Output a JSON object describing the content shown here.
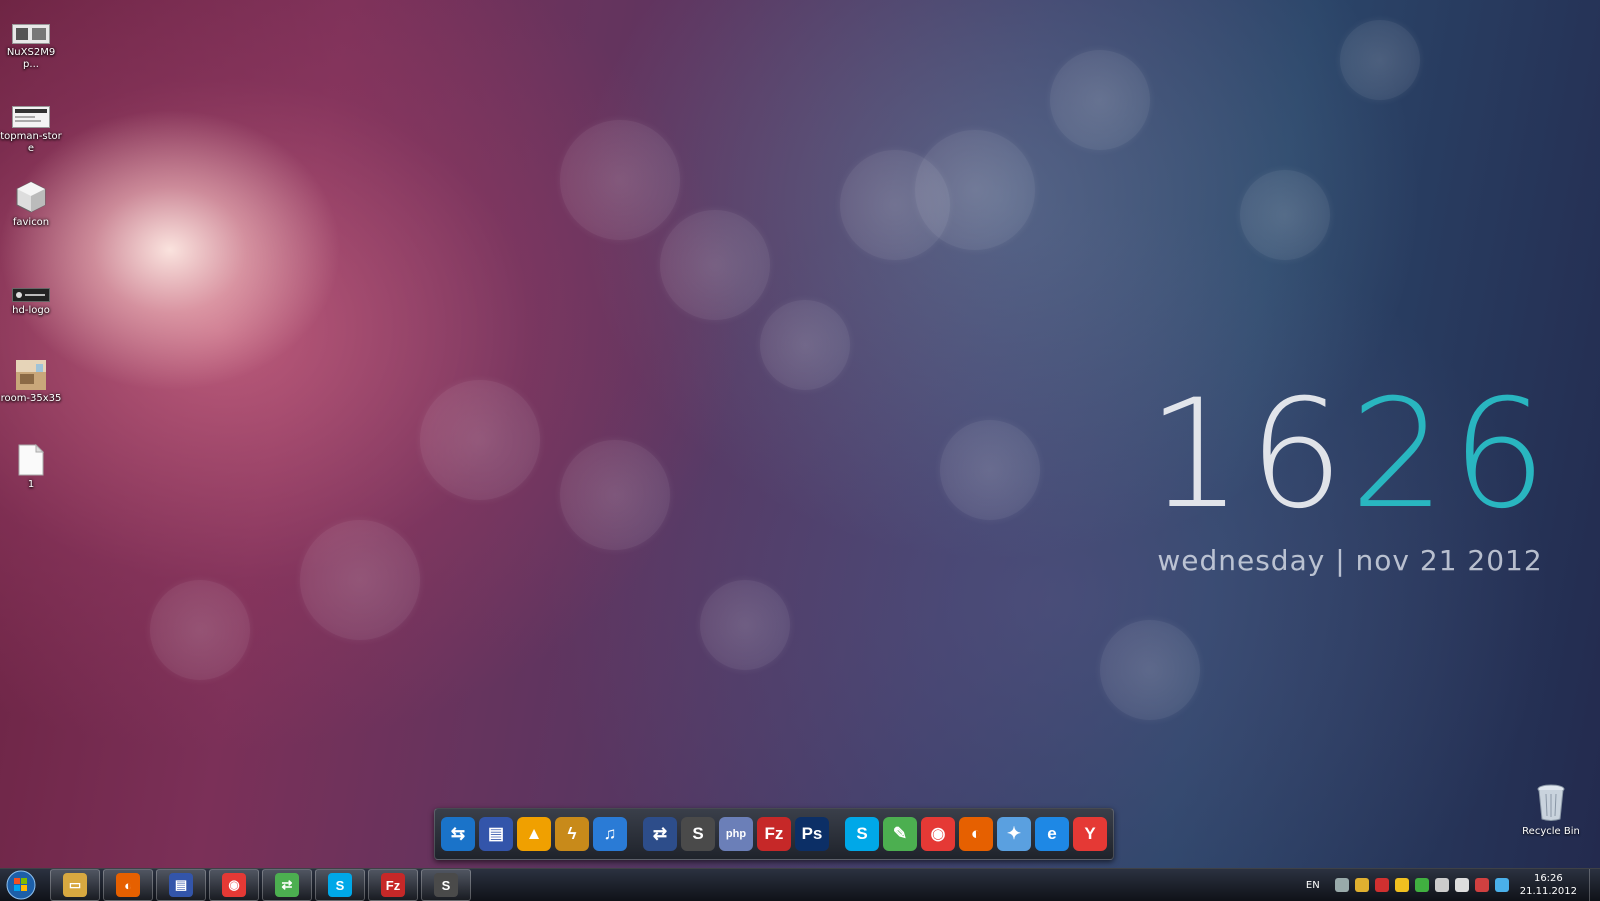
{
  "desktop_icons": [
    {
      "label": "NuXS2M9p...",
      "icon": "image-thumbnail-icon"
    },
    {
      "label": "topman-store",
      "icon": "image-thumbnail-icon"
    },
    {
      "label": "favicon",
      "icon": "favicon-cube-icon"
    },
    {
      "label": "hd-logo",
      "icon": "logo-thumbnail-icon"
    },
    {
      "label": "room-35x35",
      "icon": "room-photo-icon"
    },
    {
      "label": "1",
      "icon": "text-document-icon"
    }
  ],
  "clock_widget": {
    "hours": "16",
    "minutes": "26",
    "date_line": "wednesday | nov 21 2012",
    "accent_color": "#29b6c0"
  },
  "dock": {
    "groups": [
      [
        {
          "name": "teamviewer",
          "glyph": "⇆",
          "color": "#1a73c9"
        },
        {
          "name": "floppy-save",
          "glyph": "▤",
          "color": "#3355aa"
        },
        {
          "name": "aimp",
          "glyph": "▲",
          "color": "#f0a000"
        },
        {
          "name": "winamp",
          "glyph": "ϟ",
          "color": "#c88a1a"
        },
        {
          "name": "itunes",
          "glyph": "♫",
          "color": "#2a7bd6"
        }
      ],
      [
        {
          "name": "network-tool",
          "glyph": "⇄",
          "color": "#2d4d8a"
        },
        {
          "name": "sublime-text",
          "glyph": "S",
          "color": "#4a4a4a"
        },
        {
          "name": "php",
          "glyph": "php",
          "color": "#6b7fb8"
        },
        {
          "name": "filezilla",
          "glyph": "Fz",
          "color": "#c62828"
        },
        {
          "name": "photoshop",
          "glyph": "Ps",
          "color": "#0c2f66"
        }
      ],
      [
        {
          "name": "skype",
          "glyph": "S",
          "color": "#00a8e8"
        },
        {
          "name": "evernote-like",
          "glyph": "✎",
          "color": "#4caf50"
        },
        {
          "name": "chrome",
          "glyph": "◉",
          "color": "#e53935"
        },
        {
          "name": "firefox",
          "glyph": "◐",
          "color": "#e66000"
        },
        {
          "name": "safari",
          "glyph": "✦",
          "color": "#5aa0e0"
        },
        {
          "name": "internet-explorer",
          "glyph": "e",
          "color": "#1e88e5"
        },
        {
          "name": "yandex-browser",
          "glyph": "Y",
          "color": "#e53935"
        }
      ]
    ]
  },
  "recycle_bin": {
    "label": "Recycle Bin"
  },
  "taskbar": {
    "pinned": [
      {
        "name": "explorer",
        "glyph": "▭",
        "color": "#d8a840"
      },
      {
        "name": "firefox",
        "glyph": "◐",
        "color": "#e66000"
      },
      {
        "name": "floppy-save",
        "glyph": "▤",
        "color": "#3355aa"
      },
      {
        "name": "chrome",
        "glyph": "◉",
        "color": "#e53935"
      },
      {
        "name": "network-tool",
        "glyph": "⇄",
        "color": "#4caf50"
      },
      {
        "name": "skype",
        "glyph": "S",
        "color": "#00a8e8"
      },
      {
        "name": "filezilla",
        "glyph": "Fz",
        "color": "#c62828"
      },
      {
        "name": "sublime-text",
        "glyph": "S",
        "color": "#4a4a4a"
      }
    ],
    "tray": {
      "language": "EN",
      "time": "16:26",
      "date": "21.11.2012",
      "icons": [
        {
          "name": "drop-icon",
          "color": "#9aa"
        },
        {
          "name": "orb-icon",
          "color": "#e0b030"
        },
        {
          "name": "antivirus-icon",
          "color": "#d03030"
        },
        {
          "name": "note-icon",
          "color": "#f0c020"
        },
        {
          "name": "recycle-icon",
          "color": "#40b040"
        },
        {
          "name": "network-icon",
          "color": "#ccc"
        },
        {
          "name": "volume-icon",
          "color": "#ddd"
        },
        {
          "name": "flag-icon",
          "color": "#d04040"
        },
        {
          "name": "dropbox-icon",
          "color": "#4ab0ea"
        }
      ]
    }
  }
}
